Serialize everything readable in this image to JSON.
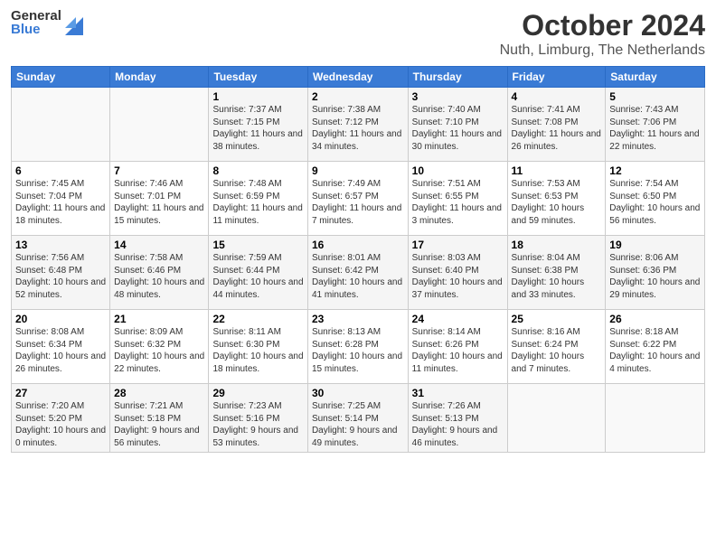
{
  "header": {
    "logo_general": "General",
    "logo_blue": "Blue",
    "month_title": "October 2024",
    "location": "Nuth, Limburg, The Netherlands"
  },
  "days_of_week": [
    "Sunday",
    "Monday",
    "Tuesday",
    "Wednesday",
    "Thursday",
    "Friday",
    "Saturday"
  ],
  "weeks": [
    [
      {
        "day": "",
        "sunrise": "",
        "sunset": "",
        "daylight": ""
      },
      {
        "day": "",
        "sunrise": "",
        "sunset": "",
        "daylight": ""
      },
      {
        "day": "1",
        "sunrise": "Sunrise: 7:37 AM",
        "sunset": "Sunset: 7:15 PM",
        "daylight": "Daylight: 11 hours and 38 minutes."
      },
      {
        "day": "2",
        "sunrise": "Sunrise: 7:38 AM",
        "sunset": "Sunset: 7:12 PM",
        "daylight": "Daylight: 11 hours and 34 minutes."
      },
      {
        "day": "3",
        "sunrise": "Sunrise: 7:40 AM",
        "sunset": "Sunset: 7:10 PM",
        "daylight": "Daylight: 11 hours and 30 minutes."
      },
      {
        "day": "4",
        "sunrise": "Sunrise: 7:41 AM",
        "sunset": "Sunset: 7:08 PM",
        "daylight": "Daylight: 11 hours and 26 minutes."
      },
      {
        "day": "5",
        "sunrise": "Sunrise: 7:43 AM",
        "sunset": "Sunset: 7:06 PM",
        "daylight": "Daylight: 11 hours and 22 minutes."
      }
    ],
    [
      {
        "day": "6",
        "sunrise": "Sunrise: 7:45 AM",
        "sunset": "Sunset: 7:04 PM",
        "daylight": "Daylight: 11 hours and 18 minutes."
      },
      {
        "day": "7",
        "sunrise": "Sunrise: 7:46 AM",
        "sunset": "Sunset: 7:01 PM",
        "daylight": "Daylight: 11 hours and 15 minutes."
      },
      {
        "day": "8",
        "sunrise": "Sunrise: 7:48 AM",
        "sunset": "Sunset: 6:59 PM",
        "daylight": "Daylight: 11 hours and 11 minutes."
      },
      {
        "day": "9",
        "sunrise": "Sunrise: 7:49 AM",
        "sunset": "Sunset: 6:57 PM",
        "daylight": "Daylight: 11 hours and 7 minutes."
      },
      {
        "day": "10",
        "sunrise": "Sunrise: 7:51 AM",
        "sunset": "Sunset: 6:55 PM",
        "daylight": "Daylight: 11 hours and 3 minutes."
      },
      {
        "day": "11",
        "sunrise": "Sunrise: 7:53 AM",
        "sunset": "Sunset: 6:53 PM",
        "daylight": "Daylight: 10 hours and 59 minutes."
      },
      {
        "day": "12",
        "sunrise": "Sunrise: 7:54 AM",
        "sunset": "Sunset: 6:50 PM",
        "daylight": "Daylight: 10 hours and 56 minutes."
      }
    ],
    [
      {
        "day": "13",
        "sunrise": "Sunrise: 7:56 AM",
        "sunset": "Sunset: 6:48 PM",
        "daylight": "Daylight: 10 hours and 52 minutes."
      },
      {
        "day": "14",
        "sunrise": "Sunrise: 7:58 AM",
        "sunset": "Sunset: 6:46 PM",
        "daylight": "Daylight: 10 hours and 48 minutes."
      },
      {
        "day": "15",
        "sunrise": "Sunrise: 7:59 AM",
        "sunset": "Sunset: 6:44 PM",
        "daylight": "Daylight: 10 hours and 44 minutes."
      },
      {
        "day": "16",
        "sunrise": "Sunrise: 8:01 AM",
        "sunset": "Sunset: 6:42 PM",
        "daylight": "Daylight: 10 hours and 41 minutes."
      },
      {
        "day": "17",
        "sunrise": "Sunrise: 8:03 AM",
        "sunset": "Sunset: 6:40 PM",
        "daylight": "Daylight: 10 hours and 37 minutes."
      },
      {
        "day": "18",
        "sunrise": "Sunrise: 8:04 AM",
        "sunset": "Sunset: 6:38 PM",
        "daylight": "Daylight: 10 hours and 33 minutes."
      },
      {
        "day": "19",
        "sunrise": "Sunrise: 8:06 AM",
        "sunset": "Sunset: 6:36 PM",
        "daylight": "Daylight: 10 hours and 29 minutes."
      }
    ],
    [
      {
        "day": "20",
        "sunrise": "Sunrise: 8:08 AM",
        "sunset": "Sunset: 6:34 PM",
        "daylight": "Daylight: 10 hours and 26 minutes."
      },
      {
        "day": "21",
        "sunrise": "Sunrise: 8:09 AM",
        "sunset": "Sunset: 6:32 PM",
        "daylight": "Daylight: 10 hours and 22 minutes."
      },
      {
        "day": "22",
        "sunrise": "Sunrise: 8:11 AM",
        "sunset": "Sunset: 6:30 PM",
        "daylight": "Daylight: 10 hours and 18 minutes."
      },
      {
        "day": "23",
        "sunrise": "Sunrise: 8:13 AM",
        "sunset": "Sunset: 6:28 PM",
        "daylight": "Daylight: 10 hours and 15 minutes."
      },
      {
        "day": "24",
        "sunrise": "Sunrise: 8:14 AM",
        "sunset": "Sunset: 6:26 PM",
        "daylight": "Daylight: 10 hours and 11 minutes."
      },
      {
        "day": "25",
        "sunrise": "Sunrise: 8:16 AM",
        "sunset": "Sunset: 6:24 PM",
        "daylight": "Daylight: 10 hours and 7 minutes."
      },
      {
        "day": "26",
        "sunrise": "Sunrise: 8:18 AM",
        "sunset": "Sunset: 6:22 PM",
        "daylight": "Daylight: 10 hours and 4 minutes."
      }
    ],
    [
      {
        "day": "27",
        "sunrise": "Sunrise: 7:20 AM",
        "sunset": "Sunset: 5:20 PM",
        "daylight": "Daylight: 10 hours and 0 minutes."
      },
      {
        "day": "28",
        "sunrise": "Sunrise: 7:21 AM",
        "sunset": "Sunset: 5:18 PM",
        "daylight": "Daylight: 9 hours and 56 minutes."
      },
      {
        "day": "29",
        "sunrise": "Sunrise: 7:23 AM",
        "sunset": "Sunset: 5:16 PM",
        "daylight": "Daylight: 9 hours and 53 minutes."
      },
      {
        "day": "30",
        "sunrise": "Sunrise: 7:25 AM",
        "sunset": "Sunset: 5:14 PM",
        "daylight": "Daylight: 9 hours and 49 minutes."
      },
      {
        "day": "31",
        "sunrise": "Sunrise: 7:26 AM",
        "sunset": "Sunset: 5:13 PM",
        "daylight": "Daylight: 9 hours and 46 minutes."
      },
      {
        "day": "",
        "sunrise": "",
        "sunset": "",
        "daylight": ""
      },
      {
        "day": "",
        "sunrise": "",
        "sunset": "",
        "daylight": ""
      }
    ]
  ]
}
